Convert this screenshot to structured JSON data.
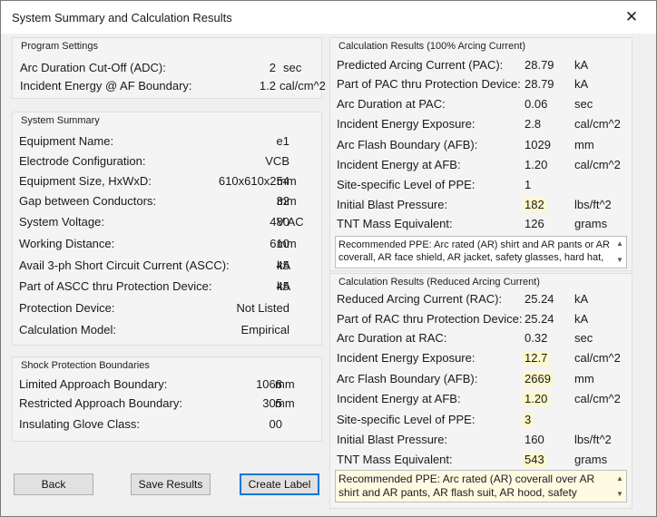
{
  "window": {
    "title": "System Summary and Calculation Results",
    "close_glyph": "✕"
  },
  "program_settings": {
    "title": "Program Settings",
    "rows": [
      {
        "label": "Arc Duration Cut-Off (ADC):",
        "value": "2",
        "unit": "sec"
      },
      {
        "label": "Incident Energy @ AF Boundary:",
        "value": "1.2",
        "unit": "cal/cm^2"
      }
    ]
  },
  "system_summary": {
    "title": "System Summary",
    "rows": [
      {
        "label": "Equipment Name:",
        "value": "e1",
        "unit": ""
      },
      {
        "label": "Electrode Configuration:",
        "value": "VCB",
        "unit": ""
      },
      {
        "label": "Equipment Size, HxWxD:",
        "value": "610x610x254",
        "unit": "mm"
      },
      {
        "label": "Gap between Conductors:",
        "value": "32",
        "unit": "mm"
      },
      {
        "label": "System Voltage:",
        "value": "480",
        "unit": "V AC"
      },
      {
        "label": "Working Distance:",
        "value": "610",
        "unit": "mm"
      },
      {
        "label": "Avail 3-ph Short Circuit Current (ASCC):",
        "value": "45",
        "unit": "kA"
      },
      {
        "label": "Part of ASCC thru Protection Device:",
        "value": "45",
        "unit": "kA"
      },
      {
        "label": "Protection Device:",
        "value": "Not Listed",
        "unit": ""
      },
      {
        "label": "Calculation Model:",
        "value": "Empirical",
        "unit": ""
      }
    ]
  },
  "shock_protection": {
    "title": "Shock Protection Boundaries",
    "rows": [
      {
        "label": "Limited Approach Boundary:",
        "value": "1068",
        "unit": "mm"
      },
      {
        "label": "Restricted Approach Boundary:",
        "value": "305",
        "unit": "mm"
      },
      {
        "label": "Insulating Glove Class:",
        "value": "00",
        "unit": ""
      }
    ]
  },
  "results_full": {
    "title": "Calculation Results (100% Arcing Current)",
    "rows": [
      {
        "label": "Predicted Arcing Current (PAC):",
        "value": "28.79",
        "unit": "kA"
      },
      {
        "label": "Part of PAC thru Protection Device:",
        "value": "28.79",
        "unit": "kA"
      },
      {
        "label": "Arc Duration at PAC:",
        "value": "0.06",
        "unit": "sec"
      },
      {
        "label": "Incident Energy Exposure:",
        "value": "2.8",
        "unit": "cal/cm^2"
      },
      {
        "label": "Arc Flash Boundary (AFB):",
        "value": "1029",
        "unit": "mm"
      },
      {
        "label": "Incident Energy at AFB:",
        "value": "1.20",
        "unit": "cal/cm^2"
      },
      {
        "label": "Site-specific Level of PPE:",
        "value": "1",
        "unit": ""
      },
      {
        "label": "Initial Blast Pressure:",
        "value": "182",
        "unit": "lbs/ft^2"
      },
      {
        "label": "TNT Mass Equivalent:",
        "value": "126",
        "unit": "grams"
      }
    ],
    "ppe_text": "Recommended PPE: Arc rated (AR) shirt and AR pants or AR coverall, AR face shield, AR jacket, safety glasses, hard hat,"
  },
  "results_reduced": {
    "title": "Calculation Results (Reduced  Arcing Current)",
    "rows": [
      {
        "label": "Reduced Arcing Current (RAC):",
        "value": "25.24",
        "unit": "kA"
      },
      {
        "label": "Part of RAC thru Protection Device:",
        "value": "25.24",
        "unit": "kA"
      },
      {
        "label": "Arc Duration at RAC:",
        "value": "0.32",
        "unit": "sec"
      },
      {
        "label": "Incident Energy Exposure:",
        "value": "12.7",
        "unit": "cal/cm^2"
      },
      {
        "label": "Arc Flash Boundary (AFB):",
        "value": "2669",
        "unit": "mm"
      },
      {
        "label": "Incident Energy at AFB:",
        "value": "1.20",
        "unit": "cal/cm^2"
      },
      {
        "label": "Site-specific Level of PPE:",
        "value": "3",
        "unit": ""
      },
      {
        "label": "Initial Blast Pressure:",
        "value": "160",
        "unit": "lbs/ft^2"
      },
      {
        "label": "TNT Mass Equivalent:",
        "value": "543",
        "unit": "grams"
      }
    ],
    "ppe_text": "Recommended PPE: Arc rated (AR) coverall over AR shirt and AR pants, AR flash suit, AR hood, safety glasses, hard hat, ear"
  },
  "buttons": {
    "back": "Back",
    "save": "Save Results",
    "create_label": "Create Label"
  },
  "colors": {
    "highlight": "#fff8cc",
    "focus_border": "#0078d7"
  }
}
